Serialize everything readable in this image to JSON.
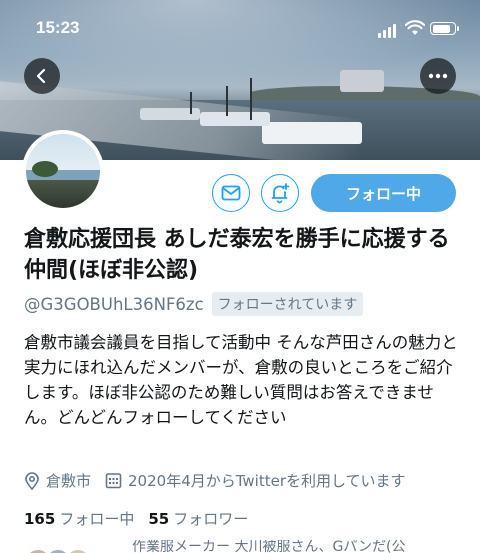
{
  "status_bar": {
    "time": "15:23",
    "battery_level": 0.85
  },
  "profile": {
    "display_name": "倉敷応援団長 あしだ泰宏を勝手に応援する仲間(ほぼ非公認)",
    "handle": "@G3GOBUhL36NF6zc",
    "follows_you_badge": "フォローされています",
    "bio": "倉敷市議会議員を目指して活動中 そんな芦田さんの魅力と実力にほれ込んだメンバーが、倉敷の良いところをご紹介します。ほぼ非公認のため難しい質問はお答えできません。どんどんフォローしてください",
    "location": "倉敷市",
    "joined": "2020年4月からTwitterを利用しています"
  },
  "actions": {
    "follow_label": "フォロー中"
  },
  "stats": {
    "following_count": "165",
    "following_label": "フォロー中",
    "followers_count": "55",
    "followers_label": "フォロワー"
  },
  "followed_by_preview": "作業服メーカー 大川被服さん、Gパンだ(公",
  "colors": {
    "accent": "#1da1f2",
    "follow_button": "#4fa8e8",
    "secondary_text": "#657786"
  },
  "icons": [
    "back-arrow-icon",
    "more-icon",
    "mail-icon",
    "bell-plus-icon",
    "location-pin-icon",
    "calendar-icon"
  ]
}
